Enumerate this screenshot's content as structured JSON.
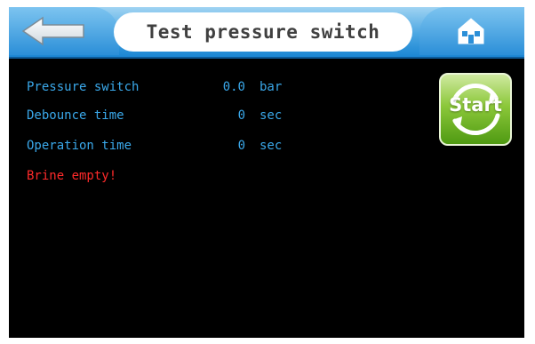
{
  "header": {
    "title": "Test pressure switch",
    "back_icon": "back-arrow-icon",
    "home_icon": "home-icon"
  },
  "rows": [
    {
      "label": "Pressure switch",
      "value": "0.0",
      "unit": "bar"
    },
    {
      "label": "Debounce time",
      "value": "0",
      "unit": "sec"
    },
    {
      "label": "Operation time",
      "value": "0",
      "unit": "sec"
    }
  ],
  "status": {
    "message": "Brine empty!"
  },
  "start_button": {
    "label": "Start"
  },
  "colors": {
    "background": "#000000",
    "header_blue": "#2b8fd8",
    "value_text": "#3aa8ea",
    "alert_text": "#ff2a2a",
    "start_green": "#8cc83a"
  }
}
